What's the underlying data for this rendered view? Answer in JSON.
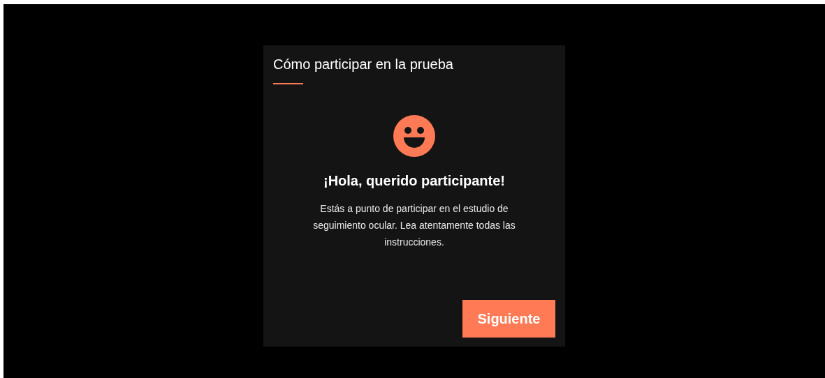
{
  "dialog": {
    "title": "Cómo participar en la prueba",
    "heading": "¡Hola, querido participante!",
    "message": "Estás a punto de participar en el estudio de seguimiento ocular. Lea atentamente todas las instrucciones.",
    "next_button": "Siguiente"
  }
}
